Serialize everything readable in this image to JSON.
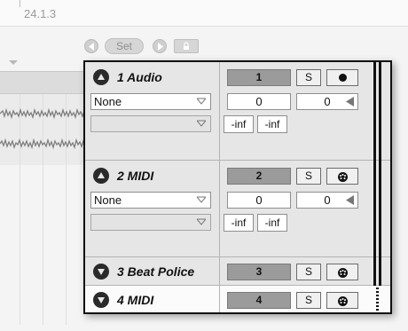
{
  "arrangement": {
    "position": "24.1.3"
  },
  "scene_nav": {
    "prev_icon": "triangle-left-icon",
    "set_label": "Set",
    "next_icon": "triangle-right-icon",
    "lock_icon": "lock-icon"
  },
  "tracks": [
    {
      "name": "1 Audio",
      "folded": false,
      "number": "1",
      "solo": "S",
      "arm_icon": "record-dot-icon",
      "input_type": "None",
      "input_channel": "",
      "volume": "0",
      "pan": "0",
      "peak_left": "-inf",
      "peak_right": "-inf"
    },
    {
      "name": "2 MIDI",
      "folded": false,
      "number": "2",
      "solo": "S",
      "arm_icon": "midi-connector-icon",
      "input_type": "None",
      "input_channel": "",
      "volume": "0",
      "pan": "0",
      "peak_left": "-inf",
      "peak_right": "-inf"
    },
    {
      "name": "3 Beat Police",
      "folded": true,
      "number": "3",
      "solo": "S",
      "arm_icon": "midi-connector-icon"
    },
    {
      "name": "4 MIDI",
      "folded": true,
      "selected": true,
      "number": "4",
      "solo": "S",
      "arm_icon": "midi-connector-icon"
    }
  ],
  "colors": {
    "track_number_bg": "#9b9b9b",
    "panel_bg": "#e4e4e4",
    "selected_track_bg": "#fbfbfb"
  }
}
